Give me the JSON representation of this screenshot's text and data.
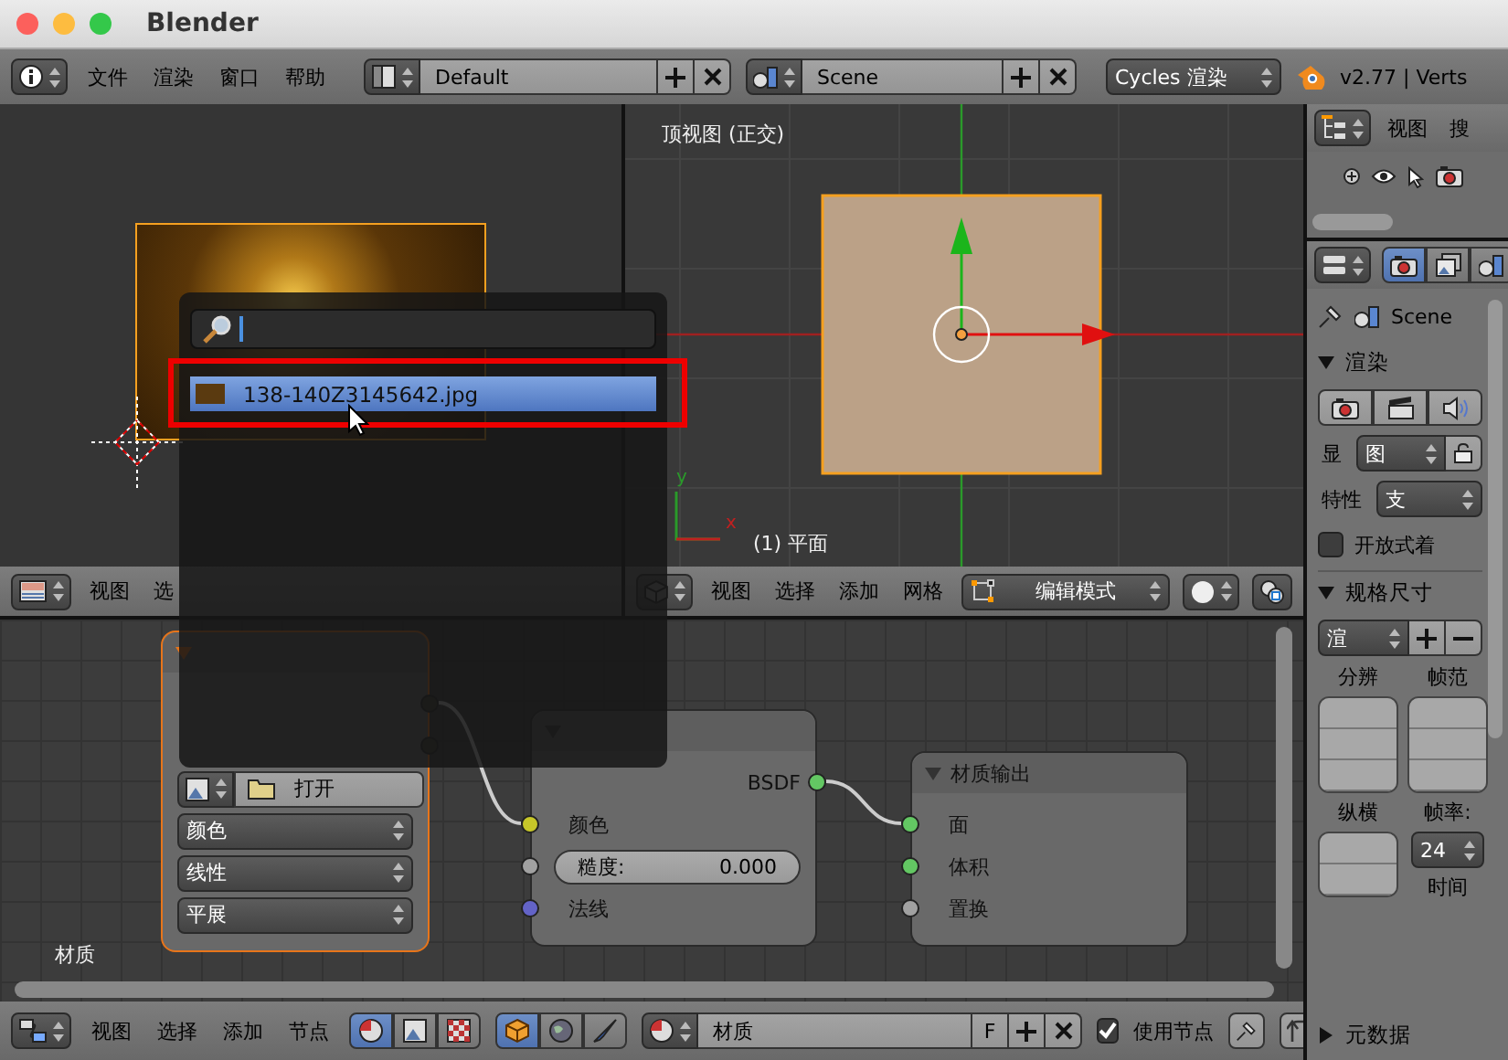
{
  "window": {
    "title": "Blender"
  },
  "top_header": {
    "menus": [
      "文件",
      "渲染",
      "窗口",
      "帮助"
    ],
    "layout": "Default",
    "scene": "Scene",
    "render_engine": "Cycles 渲染",
    "version": "v2.77 | Verts"
  },
  "image_editor": {
    "menus": [
      "视图",
      "选"
    ]
  },
  "viewport": {
    "view_label": "顶视图 (正交)",
    "object_label": "(1) 平面",
    "axis_x": "x",
    "axis_y": "y",
    "menus": [
      "视图",
      "选择",
      "添加",
      "网格"
    ],
    "mode": "编辑模式"
  },
  "image_popup": {
    "items": [
      {
        "label": "138-140Z3145642.jpg",
        "selected": true
      }
    ]
  },
  "outliner": {
    "menus": [
      "视图",
      "搜"
    ]
  },
  "properties": {
    "tabs": [
      {
        "kind": "render",
        "selected": true
      },
      {
        "kind": "layers",
        "selected": false
      },
      {
        "kind": "scene",
        "selected": false
      }
    ],
    "breadcrumb": "Scene",
    "render_panel": {
      "title": "渲染",
      "expanded": true,
      "display_label": "显",
      "display_value": "图",
      "feature_label": "特性",
      "feature_value": "支",
      "open_shading": {
        "label": "开放式着",
        "checked": false
      }
    },
    "dimensions_panel": {
      "title": "规格尺寸",
      "expanded": true,
      "preset": "渲",
      "resolution_label": "分辨",
      "frame_range_label": "帧范",
      "aspect_label": "纵横",
      "frame_rate_label": "帧率:",
      "frame_rate": "24",
      "time_label": "时间"
    },
    "metadata_panel": {
      "title": "元数据",
      "expanded": false
    }
  },
  "node_editor": {
    "material_label": "材质",
    "nodes": [
      {
        "kind": "image_texture",
        "selected": true,
        "open_button": "打开",
        "selects": [
          "颜色",
          "线性",
          "平展"
        ]
      },
      {
        "kind": "diffuse",
        "selected": false,
        "outputs": [
          {
            "label": "BSDF",
            "color": "#63c763"
          }
        ],
        "inputs": [
          {
            "kind": "socket",
            "label": "颜色",
            "color": "#c7c729"
          },
          {
            "kind": "slider",
            "label": "糙度:",
            "value": "0.000",
            "color": "#a1a1a1"
          },
          {
            "kind": "socket",
            "label": "法线",
            "color": "#6363c7"
          }
        ]
      },
      {
        "kind": "output",
        "title": "材质输出",
        "selected": false,
        "inputs": [
          {
            "kind": "socket",
            "label": "面",
            "color": "#63c763"
          },
          {
            "kind": "socket",
            "label": "体积",
            "color": "#63c763"
          },
          {
            "kind": "socket",
            "label": "置换",
            "color": "#a1a1a1"
          }
        ]
      }
    ],
    "menus": [
      "视图",
      "选择",
      "添加",
      "节点"
    ],
    "tree_tabs": [
      {
        "kind": "shader",
        "selected": true
      },
      {
        "kind": "texture",
        "selected": false
      },
      {
        "kind": "compositing",
        "selected": false
      }
    ],
    "shader_tabs": [
      {
        "kind": "object",
        "selected": true
      },
      {
        "kind": "world",
        "selected": false
      },
      {
        "kind": "linestyle",
        "selected": false
      }
    ],
    "material": "材质",
    "fake_user": "F",
    "use_nodes": {
      "label": "使用节点",
      "checked": true
    }
  }
}
